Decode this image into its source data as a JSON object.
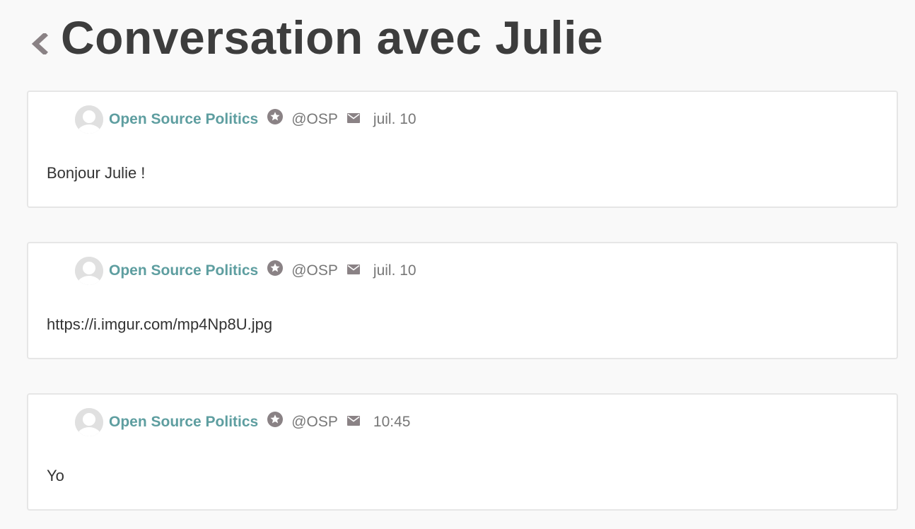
{
  "header": {
    "title": "Conversation avec Julie",
    "back_icon": "chevron-left-icon"
  },
  "colors": {
    "background": "#f9f9f9",
    "author_link": "#5e9ea0",
    "muted_text": "#777777",
    "icon_gray": "#8a8285"
  },
  "messages": [
    {
      "author": "Open Source Politics",
      "handle": "@OSP",
      "time": "juil. 10",
      "body": "Bonjour Julie !"
    },
    {
      "author": "Open Source Politics",
      "handle": "@OSP",
      "time": "juil. 10",
      "body": "https://i.imgur.com/mp4Np8U.jpg"
    },
    {
      "author": "Open Source Politics",
      "handle": "@OSP",
      "time": "10:45",
      "body": "Yo"
    }
  ]
}
